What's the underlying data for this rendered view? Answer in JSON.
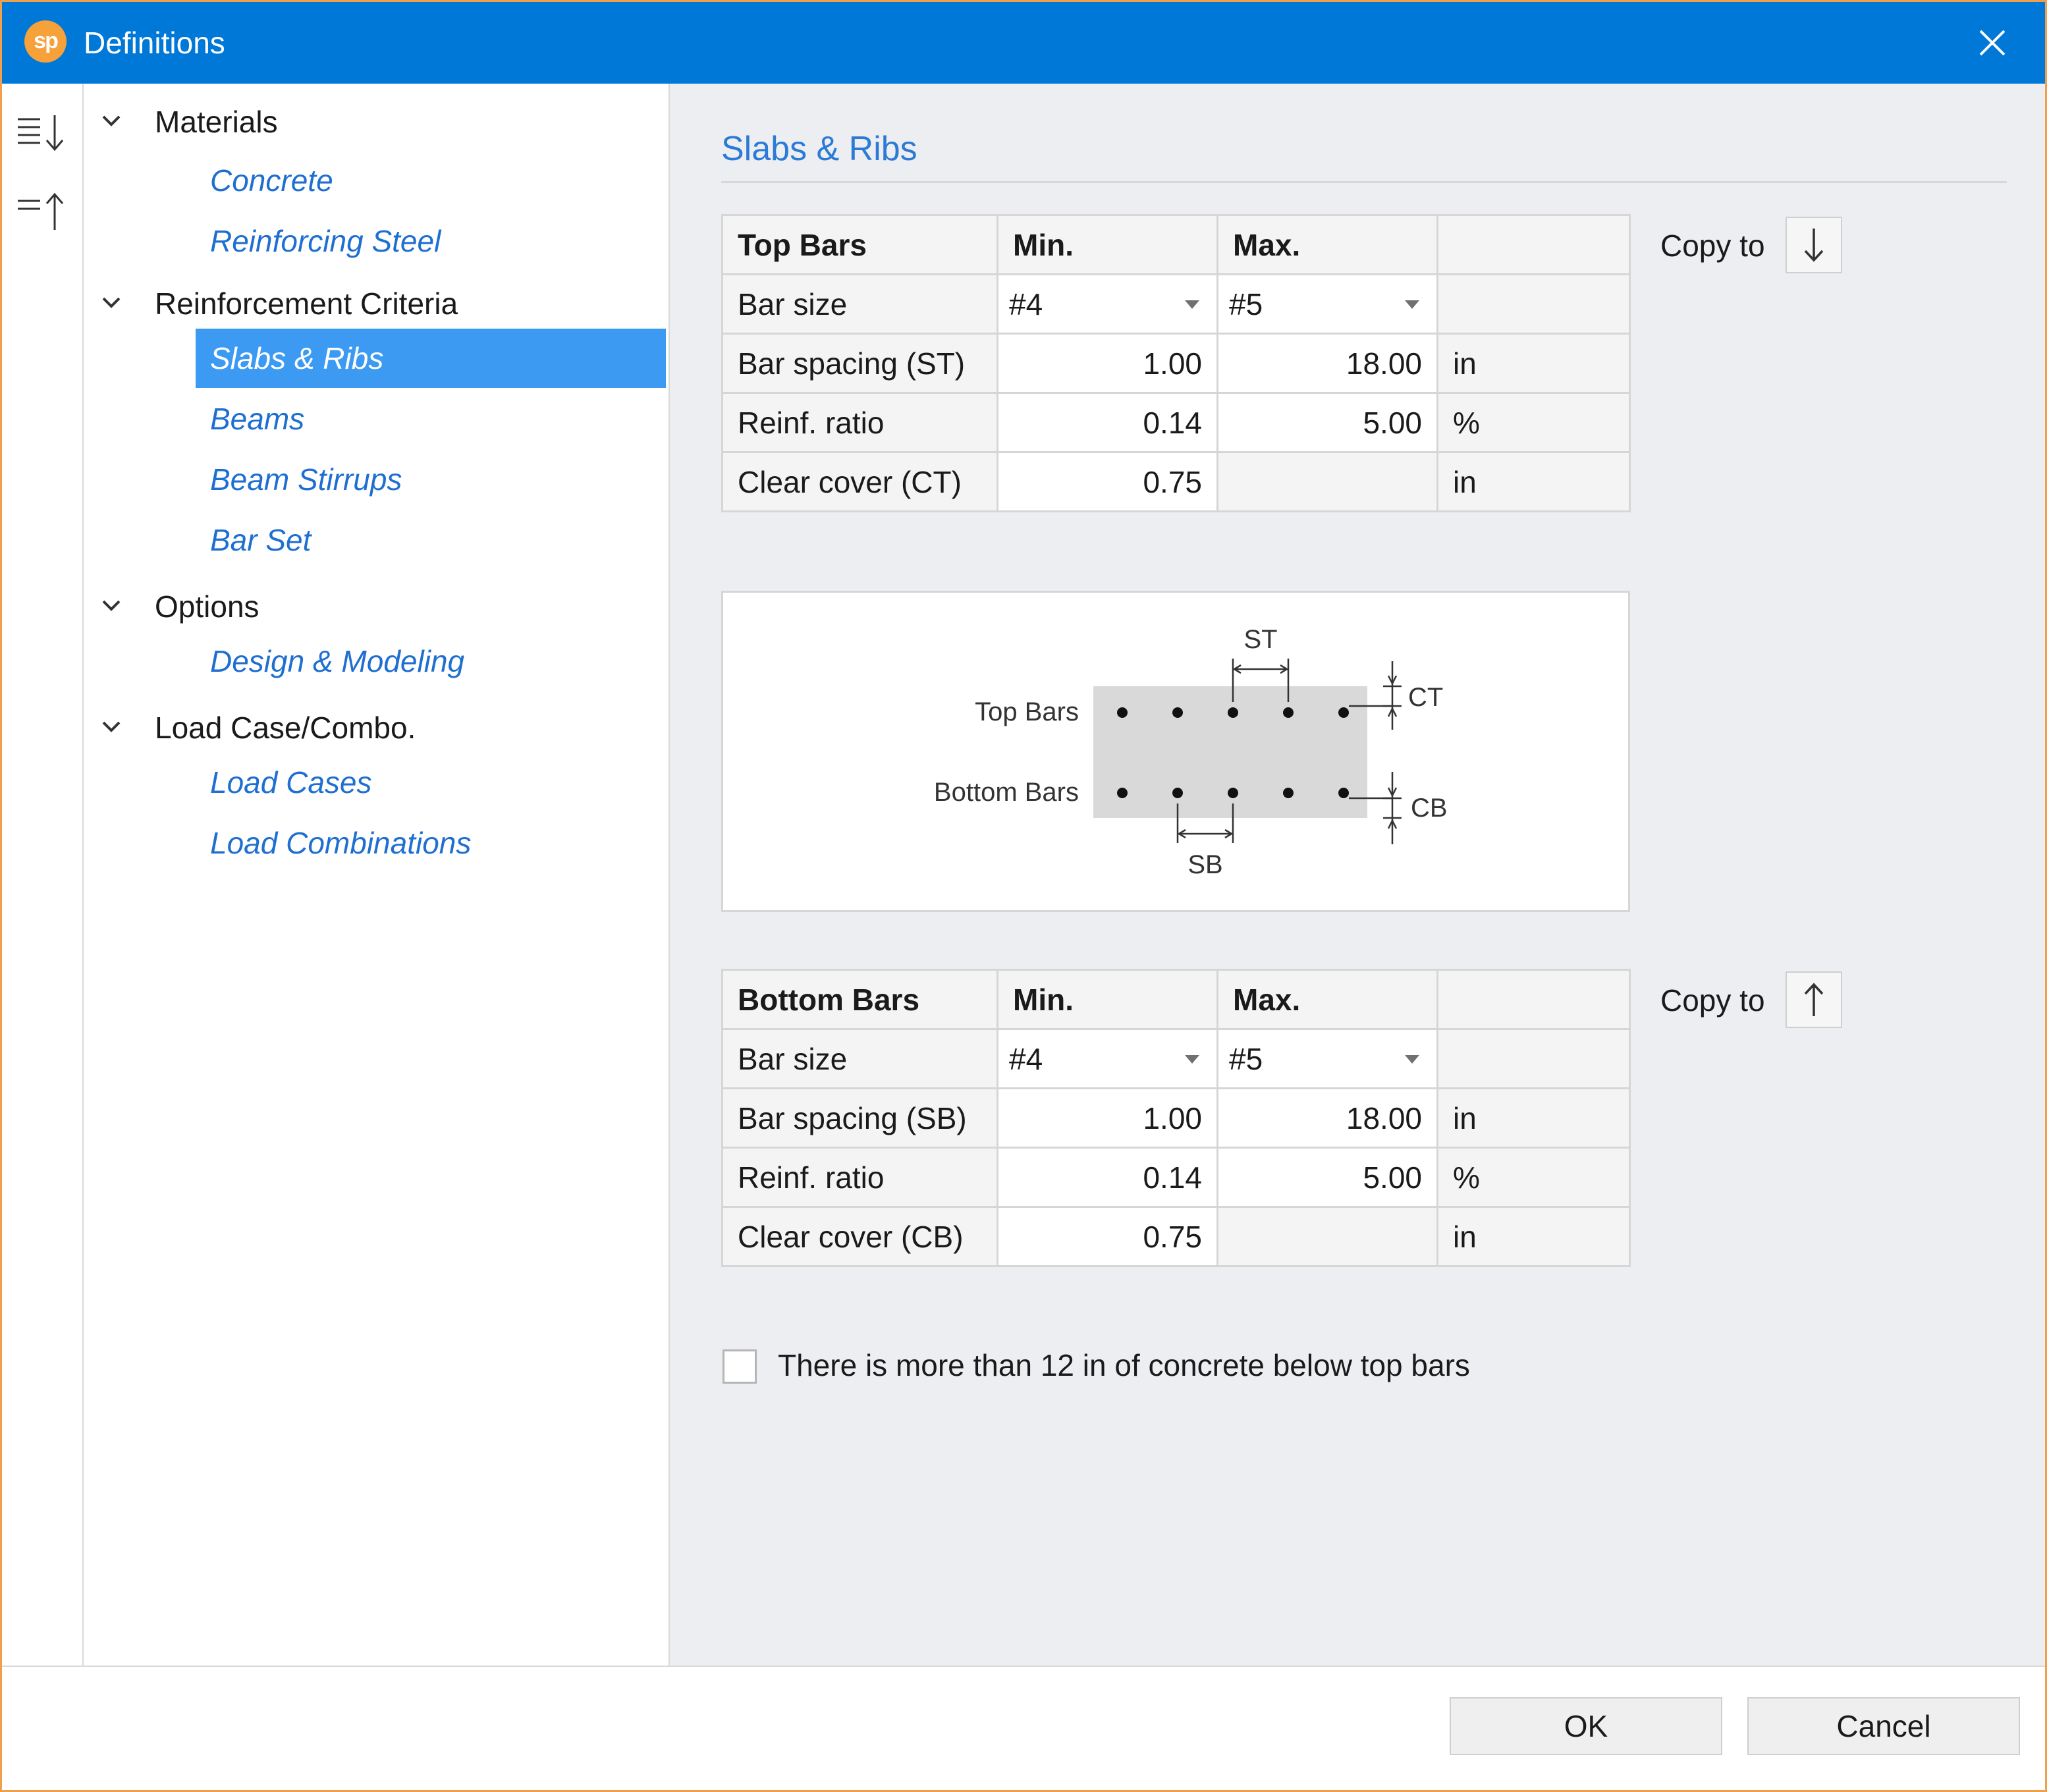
{
  "window": {
    "title": "Definitions",
    "logo_text": "sp"
  },
  "tree": {
    "groups": [
      {
        "label": "Materials",
        "items": [
          "Concrete",
          "Reinforcing Steel"
        ]
      },
      {
        "label": "Reinforcement Criteria",
        "items": [
          "Slabs & Ribs",
          "Beams",
          "Beam Stirrups",
          "Bar Set"
        ]
      },
      {
        "label": "Options",
        "items": [
          "Design & Modeling"
        ]
      },
      {
        "label": "Load Case/Combo.",
        "items": [
          "Load Cases",
          "Load Combinations"
        ]
      }
    ],
    "selected": "Slabs & Ribs"
  },
  "panel": {
    "title": "Slabs & Ribs"
  },
  "top_table": {
    "headers": [
      "Top Bars",
      "Min.",
      "Max.",
      ""
    ],
    "rows": [
      {
        "label": "Bar size",
        "min": "#4",
        "max": "#5",
        "unit": ""
      },
      {
        "label": "Bar spacing (ST)",
        "min": "1.00",
        "max": "18.00",
        "unit": "in"
      },
      {
        "label": "Reinf. ratio",
        "min": "0.14",
        "max": "5.00",
        "unit": "%"
      },
      {
        "label": "Clear cover (CT)",
        "min": "0.75",
        "max": "",
        "unit": "in"
      }
    ],
    "copy_label": "Copy to"
  },
  "bottom_table": {
    "headers": [
      "Bottom Bars",
      "Min.",
      "Max.",
      ""
    ],
    "rows": [
      {
        "label": "Bar size",
        "min": "#4",
        "max": "#5",
        "unit": ""
      },
      {
        "label": "Bar spacing (SB)",
        "min": "1.00",
        "max": "18.00",
        "unit": "in"
      },
      {
        "label": "Reinf. ratio",
        "min": "0.14",
        "max": "5.00",
        "unit": "%"
      },
      {
        "label": "Clear cover (CB)",
        "min": "0.75",
        "max": "",
        "unit": "in"
      }
    ],
    "copy_label": "Copy to"
  },
  "diagram": {
    "top_label": "Top Bars",
    "bottom_label": "Bottom Bars",
    "st": "ST",
    "sb": "SB",
    "ct": "CT",
    "cb": "CB"
  },
  "checkbox": {
    "label": "There is more than 12 in of concrete below top bars",
    "checked": false
  },
  "buttons": {
    "ok": "OK",
    "cancel": "Cancel"
  },
  "icons": {
    "logo": "sp-logo-icon",
    "close": "close-icon",
    "expand_all": "expand-all-icon",
    "collapse_all": "collapse-all-icon",
    "chevron": "chevron-down-icon",
    "copy_down": "arrow-down-icon",
    "copy_up": "arrow-up-icon",
    "dropdown": "dropdown-arrow-icon"
  },
  "colors": {
    "titlebar": "#0078d7",
    "accent_link": "#1f6fd1",
    "selection": "#3d9af2",
    "section_title": "#2b7bd6",
    "window_border": "#f0a04b",
    "logo": "#f7a13b"
  }
}
